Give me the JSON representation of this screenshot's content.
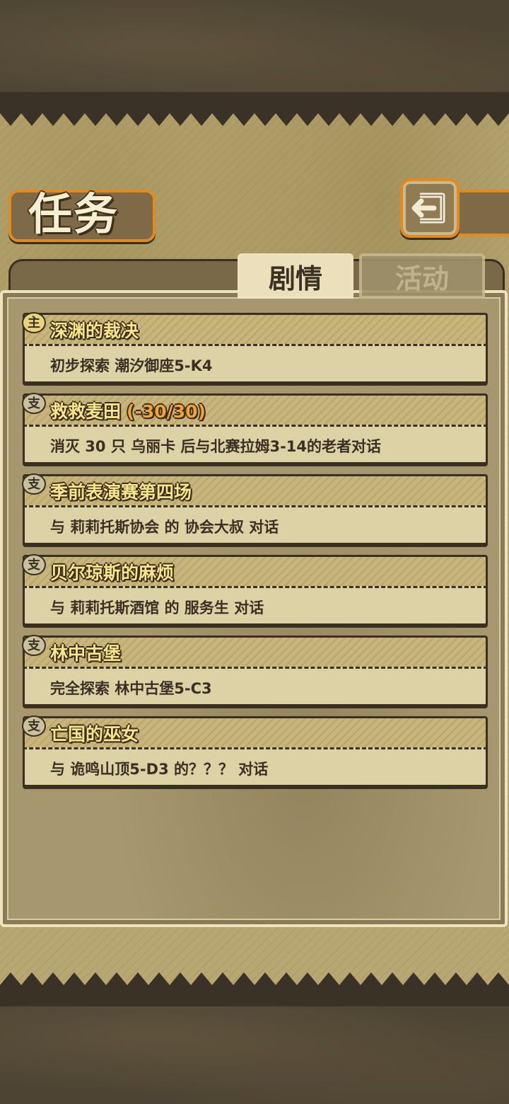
{
  "header": {
    "title": "任务",
    "back_icon": "return-arrow-icon"
  },
  "tabs": [
    {
      "label": "剧情",
      "active": true
    },
    {
      "label": "活动",
      "active": false
    }
  ],
  "quests": [
    {
      "badge": "主",
      "type": "main",
      "name": "深渊的裁决",
      "progress": "",
      "desc": "初步探索 潮汐御座5-K4"
    },
    {
      "badge": "支",
      "type": "side",
      "name": "救救麦田",
      "progress": "(-30/30)",
      "desc": "消灭 30 只 乌丽卡 后与北赛拉姆3-14的老者对话"
    },
    {
      "badge": "支",
      "type": "side",
      "name": "季前表演赛第四场",
      "progress": "",
      "desc": "与 莉莉托斯协会 的 协会大叔 对话"
    },
    {
      "badge": "支",
      "type": "side",
      "name": "贝尔琼斯的麻烦",
      "progress": "",
      "desc": "与 莉莉托斯酒馆 的 服务生 对话"
    },
    {
      "badge": "支",
      "type": "side",
      "name": "林中古堡",
      "progress": "",
      "desc": "完全探索 林中古堡5-C3"
    },
    {
      "badge": "支",
      "type": "side",
      "name": "亡国的巫女",
      "progress": "",
      "desc": "与 诡鸣山顶5-D3  的？？？ 对话"
    }
  ],
  "colors": {
    "accent": "#e08a20",
    "quest_name": "#f7e58c",
    "progress": "#f2a23b"
  }
}
